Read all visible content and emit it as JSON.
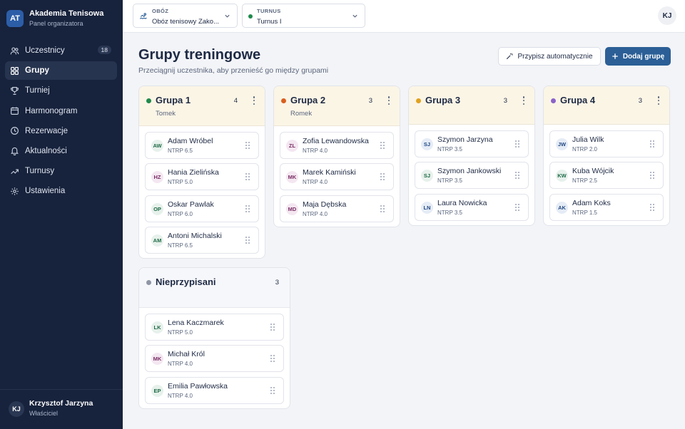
{
  "brand": {
    "logo": "AT",
    "title": "Akademia Tenisowa",
    "subtitle": "Panel organizatora"
  },
  "nav": [
    {
      "label": "Uczestnicy",
      "icon": "users-icon",
      "badge": "18"
    },
    {
      "label": "Grupy",
      "icon": "grid-icon",
      "active": true
    },
    {
      "label": "Turniej",
      "icon": "trophy-icon"
    },
    {
      "label": "Harmonogram",
      "icon": "calendar-icon"
    },
    {
      "label": "Rezerwacje",
      "icon": "clock-icon"
    },
    {
      "label": "Aktualności",
      "icon": "bell-icon"
    },
    {
      "label": "Turnusy",
      "icon": "chart-icon"
    },
    {
      "label": "Ustawienia",
      "icon": "gear-icon"
    }
  ],
  "user": {
    "initials": "KJ",
    "name": "Krzysztof Jarzyna",
    "role": "Właściciel"
  },
  "topbar": {
    "camp": {
      "label": "OBÓZ",
      "value": "Obóz tenisowy Zako..."
    },
    "session": {
      "label": "TURNUS",
      "value": "Turnus I"
    },
    "avatar": "KJ"
  },
  "header": {
    "title": "Grupy treningowe",
    "subtitle": "Przeciągnij uczestnika, aby przenieść go między grupami",
    "auto_button": "Przypisz automatycznie",
    "add_button": "Dodaj grupę"
  },
  "groups": [
    {
      "title": "Grupa 1",
      "count": "4",
      "coach": "Tomek",
      "color": "#1f8a4c",
      "members": [
        {
          "initials": "AW",
          "name": "Adam Wróbel",
          "ntrp": "NTRP 6.5",
          "tone": "g"
        },
        {
          "initials": "HZ",
          "name": "Hania Zielińska",
          "ntrp": "NTRP 5.0",
          "tone": "p"
        },
        {
          "initials": "OP",
          "name": "Oskar Pawlak",
          "ntrp": "NTRP 6.0",
          "tone": "g"
        },
        {
          "initials": "AM",
          "name": "Antoni Michalski",
          "ntrp": "NTRP 6.5",
          "tone": "g"
        }
      ]
    },
    {
      "title": "Grupa 2",
      "count": "3",
      "coach": "Romek",
      "color": "#d9601e",
      "members": [
        {
          "initials": "ZL",
          "name": "Zofia Lewandowska",
          "ntrp": "NTRP 4.0",
          "tone": "p"
        },
        {
          "initials": "MK",
          "name": "Marek Kamiński",
          "ntrp": "NTRP 4.0",
          "tone": "p"
        },
        {
          "initials": "MD",
          "name": "Maja Dębska",
          "ntrp": "NTRP 4.0",
          "tone": "p"
        }
      ]
    },
    {
      "title": "Grupa 3",
      "count": "3",
      "coach": "",
      "color": "#e0a21f",
      "members": [
        {
          "initials": "SJ",
          "name": "Szymon Jarzyna",
          "ntrp": "NTRP 3.5",
          "tone": "b"
        },
        {
          "initials": "SJ",
          "name": "Szymon Jankowski",
          "ntrp": "NTRP 3.5",
          "tone": "g"
        },
        {
          "initials": "LN",
          "name": "Laura Nowicka",
          "ntrp": "NTRP 3.5",
          "tone": "b"
        }
      ]
    },
    {
      "title": "Grupa 4",
      "count": "3",
      "coach": "",
      "color": "#8a63c9",
      "members": [
        {
          "initials": "JW",
          "name": "Julia Wilk",
          "ntrp": "NTRP 2.0",
          "tone": "b"
        },
        {
          "initials": "KW",
          "name": "Kuba Wójcik",
          "ntrp": "NTRP 2.5",
          "tone": "g"
        },
        {
          "initials": "AK",
          "name": "Adam Koks",
          "ntrp": "NTRP 1.5",
          "tone": "b"
        }
      ]
    }
  ],
  "unassigned": {
    "title": "Nieprzypisani",
    "count": "3",
    "color": "#8f97a6",
    "members": [
      {
        "initials": "LK",
        "name": "Lena Kaczmarek",
        "ntrp": "NTRP 5.0",
        "tone": "g"
      },
      {
        "initials": "MK",
        "name": "Michał Król",
        "ntrp": "NTRP 4.0",
        "tone": "p"
      },
      {
        "initials": "EP",
        "name": "Emilia Pawłowska",
        "ntrp": "NTRP 4.0",
        "tone": "g"
      }
    ]
  }
}
